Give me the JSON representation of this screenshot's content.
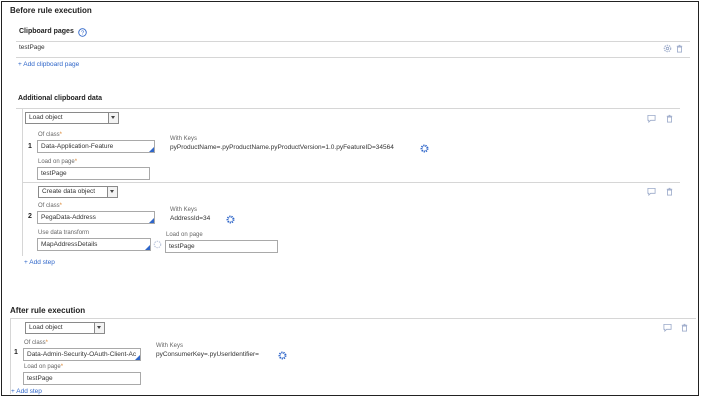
{
  "before": {
    "title": "Before rule execution",
    "clipboard_pages": {
      "heading": "Clipboard pages",
      "help_icon": "help-icon",
      "page_name": "testPage",
      "add_link": "Add clipboard page"
    },
    "additional": {
      "heading": "Additional clipboard data",
      "steps": [
        {
          "number": "1",
          "action": "Load object",
          "of_class_label": "Of class",
          "of_class": "Data-Application-Feature",
          "load_on_page_label": "Load on page",
          "load_on_page": "testPage",
          "with_keys_label": "With Keys",
          "with_keys": "pyProductName=.pyProductName.pyProductVersion=1.0.pyFeatureID=34564"
        },
        {
          "number": "2",
          "action": "Create data object",
          "of_class_label": "Of class",
          "of_class": "PegaData-Address",
          "data_transform_label": "Use data transform",
          "data_transform": "MapAddressDetails",
          "with_keys_label": "With Keys",
          "with_keys": "AddressId=34",
          "load_on_page_label": "Load on page",
          "load_on_page": "testPage"
        }
      ],
      "add_step": "Add step"
    }
  },
  "after": {
    "title": "After rule execution",
    "steps": [
      {
        "number": "1",
        "action": "Load object",
        "of_class_label": "Of class",
        "of_class": "Data-Admin-Security-OAuth-Client-Ac",
        "load_on_page_label": "Load on page",
        "load_on_page": "testPage",
        "with_keys_label": "With Keys",
        "with_keys": "pyConsumerKey=.pyUserIdentifier="
      }
    ],
    "add_step": "Add step"
  },
  "required_mark": "*",
  "colors": {
    "link": "#2f66c9",
    "required": "#d9822b",
    "border": "#222222"
  }
}
